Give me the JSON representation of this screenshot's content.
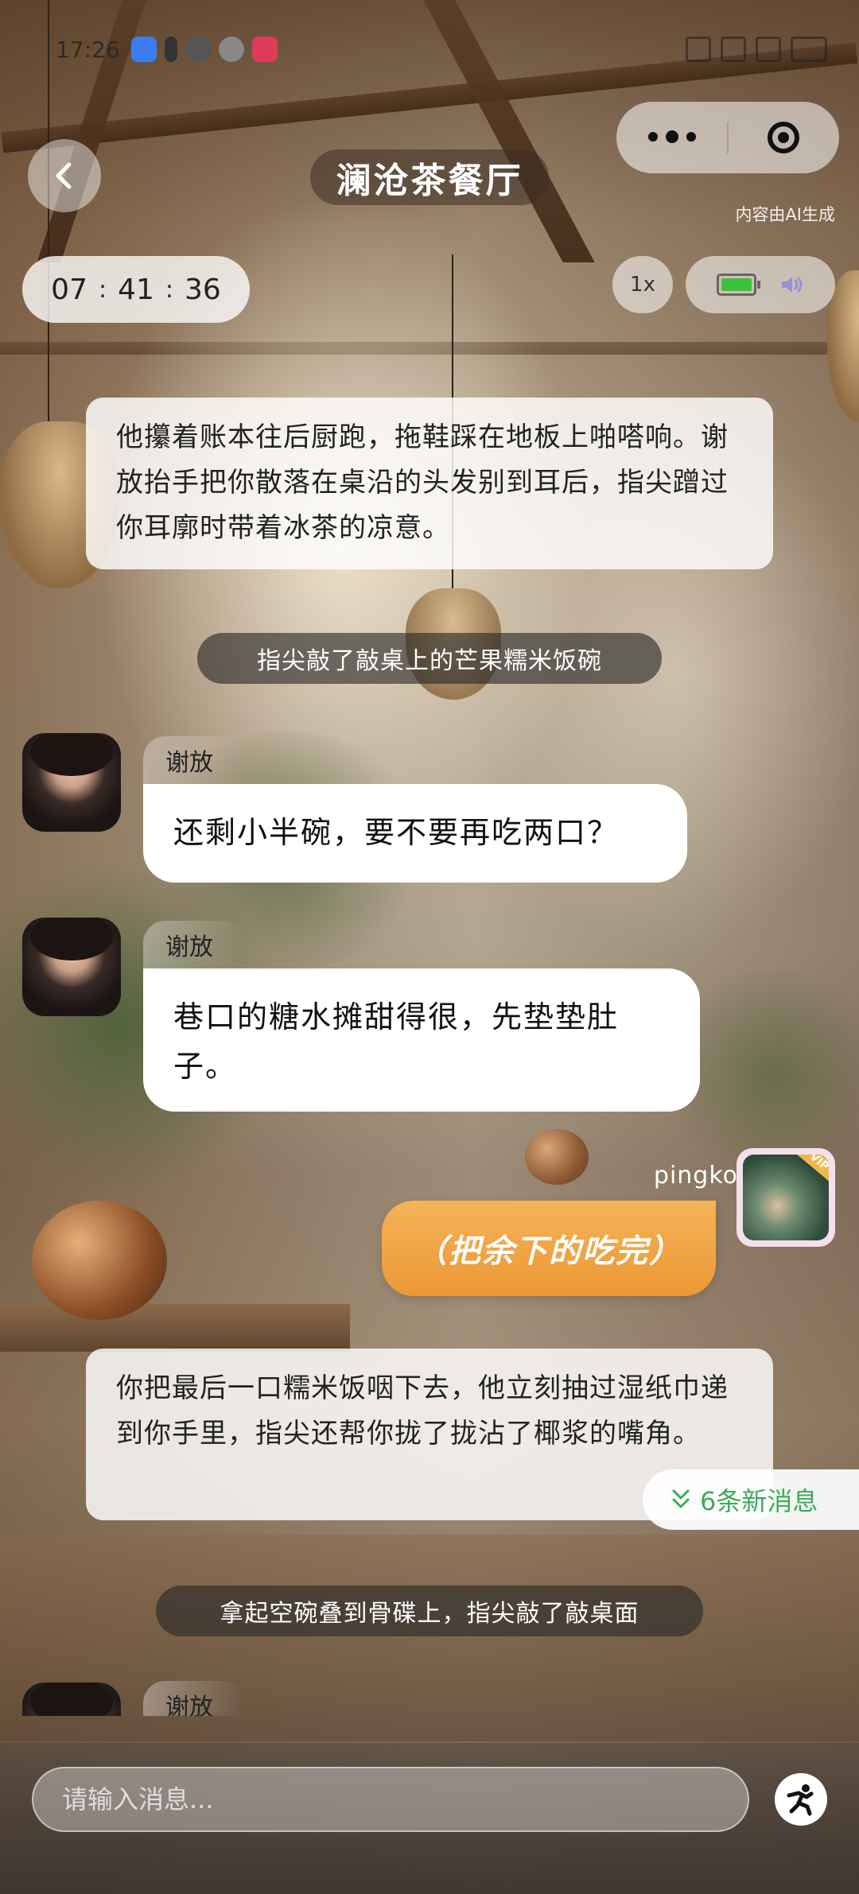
{
  "status_bar": {
    "time": "17:26"
  },
  "header": {
    "title": "澜沧茶餐厅",
    "ai_note": "内容由AI生成"
  },
  "timer": {
    "hours": "07",
    "minutes": "41",
    "seconds": "36",
    "separator": ":"
  },
  "controls": {
    "speed_label": "1x"
  },
  "chat": {
    "narration_1": "他攥着账本往后厨跑，拖鞋踩在地板上啪嗒响。谢放抬手把你散落在桌沿的头发别到耳后，指尖蹭过你耳廓时带着冰茶的凉意。",
    "action_1": "指尖敲了敲桌上的芒果糯米饭碗",
    "messages": [
      {
        "name": "谢放",
        "text": "还剩小半碗，要不要再吃两口？"
      },
      {
        "name": "谢放",
        "text": "巷口的糖水摊甜得很，先垫垫肚子。"
      }
    ],
    "user_name": "pingko",
    "user_message": "（把余下的吃完）",
    "narration_2": "你把最后一口糯米饭咽下去，他立刻抽过湿纸巾递到你手里，指尖还帮你拢了拢沾了椰浆的嘴角。",
    "new_messages_label": "6条新消息",
    "action_2": "拿起空碗叠到骨碟上，指尖敲了敲桌面",
    "partial_name": "谢放"
  },
  "input": {
    "placeholder": "请输入消息..."
  },
  "colors": {
    "user_bubble": "#ec9833",
    "new_msg_green": "#3cab5a",
    "battery_green": "#3cc13c"
  }
}
